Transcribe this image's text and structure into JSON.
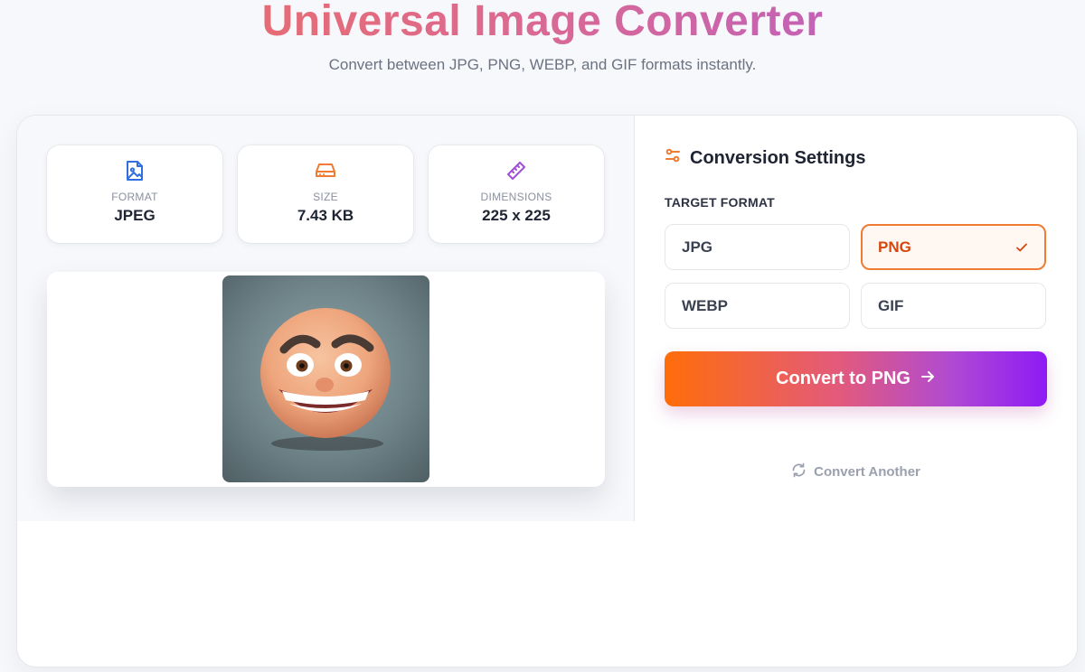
{
  "header": {
    "title": "Universal Image Converter",
    "subtitle": "Convert between JPG, PNG, WEBP, and GIF formats instantly."
  },
  "stats": [
    {
      "label": "FORMAT",
      "value": "JPEG",
      "icon": "image-file-icon",
      "color": "#2f6fe0"
    },
    {
      "label": "SIZE",
      "value": "7.43 KB",
      "icon": "hard-drive-icon",
      "color": "#f07b32"
    },
    {
      "label": "DIMENSIONS",
      "value": "225 x 225",
      "icon": "ruler-icon",
      "color": "#a24fd8"
    }
  ],
  "preview": {
    "image": "emoji-face-image"
  },
  "settings": {
    "title": "Conversion Settings",
    "target_label": "TARGET FORMAT",
    "formats": [
      "JPG",
      "PNG",
      "WEBP",
      "GIF"
    ],
    "selected": "PNG",
    "convert_label": "Convert to PNG",
    "another_label": "Convert Another"
  },
  "colors": {
    "accent": "#f07b32",
    "selected_text": "#d4470e",
    "button_gradient_start": "#ff6d0a",
    "button_gradient_end": "#8f1af5"
  }
}
